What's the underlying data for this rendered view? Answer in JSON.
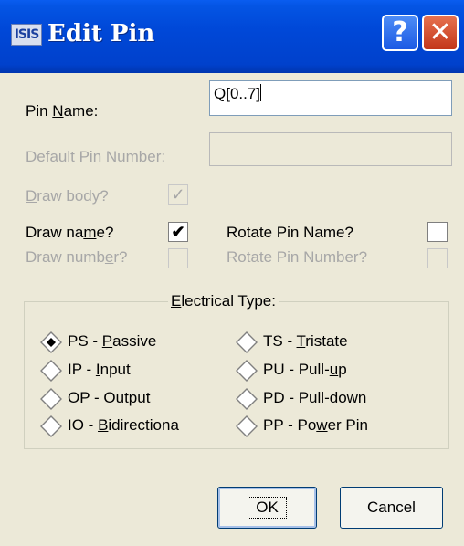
{
  "window": {
    "app_icon_text": "ISIS",
    "title": "Edit Pin",
    "help_label": "?",
    "close_label": "✕"
  },
  "fields": {
    "pin_name_label": "Pin Name:",
    "pin_name_value": "Q[0..7]",
    "default_pin_number_label": "Default Pin Number:",
    "default_pin_number_value": ""
  },
  "checks": {
    "draw_body": {
      "label": "Draw body?",
      "checked": true,
      "enabled": false
    },
    "draw_name": {
      "label": "Draw name?",
      "checked": true,
      "enabled": true
    },
    "draw_number": {
      "label": "Draw number?",
      "checked": false,
      "enabled": false
    },
    "rotate_pin_name": {
      "label": "Rotate Pin Name?",
      "checked": false,
      "enabled": true
    },
    "rotate_pin_number": {
      "label": "Rotate Pin Number?",
      "checked": false,
      "enabled": false
    }
  },
  "electrical": {
    "title": "Electrical Type:",
    "selected": "PS - Passive",
    "left": [
      "PS - Passive",
      "IP - Input",
      "OP - Output",
      "IO - Bidirectiona"
    ],
    "right": [
      "TS - Tristate",
      "PU - Pull-up",
      "PD - Pull-down",
      "PP - Power Pin"
    ]
  },
  "buttons": {
    "ok": "OK",
    "cancel": "Cancel"
  },
  "colors": {
    "titlebar": "#0048d8",
    "dialog_bg": "#ece9d8",
    "close_button": "#c3361a",
    "disabled_text": "#a7a7a7"
  }
}
